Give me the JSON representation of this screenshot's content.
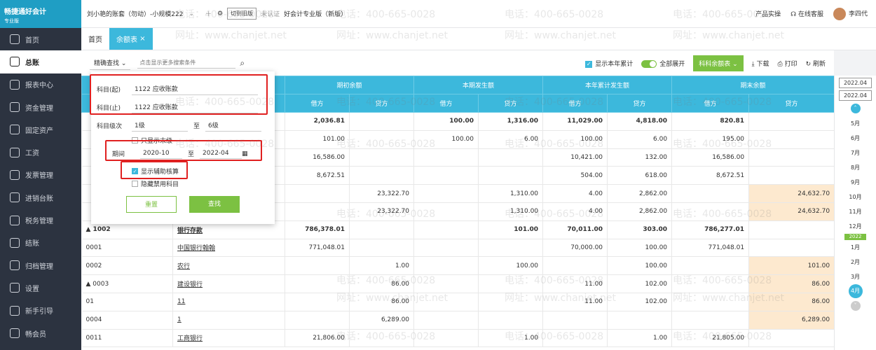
{
  "app": {
    "logo_text": "畅捷通好会计",
    "logo_sub": "专业版"
  },
  "sidebar": {
    "items": [
      {
        "label": "首页",
        "icon": "home-icon"
      },
      {
        "label": "总账",
        "icon": "ledger-icon"
      },
      {
        "label": "报表中心",
        "icon": "report-icon"
      },
      {
        "label": "资金管理",
        "icon": "fund-icon"
      },
      {
        "label": "固定资产",
        "icon": "asset-icon"
      },
      {
        "label": "工资",
        "icon": "salary-icon"
      },
      {
        "label": "发票管理",
        "icon": "invoice-icon"
      },
      {
        "label": "进销台账",
        "icon": "inventory-icon"
      },
      {
        "label": "税务管理",
        "icon": "tax-icon"
      },
      {
        "label": "结账",
        "icon": "close-icon"
      },
      {
        "label": "归档管理",
        "icon": "archive-icon"
      },
      {
        "label": "设置",
        "icon": "gear-icon"
      },
      {
        "label": "新手引导",
        "icon": "guide-icon"
      },
      {
        "label": "畅会员",
        "icon": "member-icon"
      }
    ],
    "active_index": 1
  },
  "topbar": {
    "account": "刘小艳的账套（勿动）-小规模222",
    "switch_old": "切到旧版",
    "cert": "未认证",
    "edition": "好会计专业版（新版）",
    "notice": "产品实操",
    "service": "在线客服",
    "user": "李四代"
  },
  "tabs": [
    {
      "label": "首页"
    },
    {
      "label": "余额表"
    }
  ],
  "toolbar": {
    "search_mode": "精确查找",
    "search_placeholder": "点击显示更多搜索条件",
    "show_year": "显示本年累计",
    "expand_all": "全部展开",
    "subject_balance": "科科余额表",
    "download": "下载",
    "print": "打印",
    "refresh": "刷新"
  },
  "panel": {
    "subject_from_label": "科目(起)",
    "subject_from": "1122 应收账款",
    "subject_to_label": "科目(止)",
    "subject_to": "1122 应收账款",
    "level_label": "科目级次",
    "level_from": "1级",
    "level_sep": "至",
    "level_to": "6级",
    "only_leaf": "只显示末级",
    "period_label": "期间",
    "period_from": "2020-10",
    "period_sep": "至",
    "period_to": "2022-04",
    "show_aux": "显示辅助核算",
    "hide_disabled": "隐藏禁用科目",
    "reset": "重置",
    "search": "查找"
  },
  "table": {
    "groups": [
      "期初余额",
      "本期发生额",
      "本年累计发生额",
      "期末余额"
    ],
    "sub": [
      "借方",
      "贷方"
    ],
    "rows": [
      {
        "c": [
          "",
          "",
          "2,036.81",
          "",
          "100.00",
          "1,316.00",
          "11,029.00",
          "4,818.00",
          "820.81",
          ""
        ],
        "bold": true
      },
      {
        "c": [
          "",
          "",
          "101.00",
          "",
          "100.00",
          "6.00",
          "100.00",
          "6.00",
          "195.00",
          ""
        ]
      },
      {
        "c": [
          "",
          "",
          "16,586.00",
          "",
          "",
          "",
          "10,421.00",
          "132.00",
          "16,586.00",
          ""
        ]
      },
      {
        "c": [
          "",
          "",
          "8,672.51",
          "",
          "",
          "",
          "504.00",
          "618.00",
          "8,672.51",
          ""
        ]
      },
      {
        "c": [
          "",
          "",
          "",
          "23,322.70",
          "",
          "1,310.00",
          "4.00",
          "2,862.00",
          "",
          "24,632.70"
        ]
      },
      {
        "c": [
          "",
          "",
          "",
          "23,322.70",
          "",
          "1,310.00",
          "4.00",
          "2,862.00",
          "",
          "24,632.70"
        ]
      },
      {
        "c": [
          "▲ 1002",
          "银行存款",
          "786,378.01",
          "",
          "",
          "101.00",
          "70,011.00",
          "303.00",
          "786,277.01",
          ""
        ],
        "bold": true
      },
      {
        "c": [
          "0001",
          "中国银行翰翰",
          "771,048.01",
          "",
          "",
          "",
          "70,000.00",
          "100.00",
          "771,048.01",
          ""
        ]
      },
      {
        "c": [
          "0002",
          "农行",
          "",
          "1.00",
          "",
          "100.00",
          "",
          "100.00",
          "",
          "101.00"
        ]
      },
      {
        "c": [
          "▲ 0003",
          "建设银行",
          "",
          "86.00",
          "",
          "",
          "11.00",
          "102.00",
          "",
          "86.00"
        ]
      },
      {
        "c": [
          "01",
          "11",
          "",
          "86.00",
          "",
          "",
          "11.00",
          "102.00",
          "",
          "86.00"
        ]
      },
      {
        "c": [
          "0004",
          "1",
          "",
          "6,289.00",
          "",
          "",
          "",
          "",
          "",
          "6,289.00"
        ]
      },
      {
        "c": [
          "0011",
          "工商银行",
          "21,806.00",
          "",
          "",
          "1.00",
          "",
          "1.00",
          "21,805.00",
          ""
        ]
      }
    ]
  },
  "timeline": {
    "year_from": "2022.04",
    "year_to": "2022.04",
    "months_top": [
      "5月",
      "6月",
      "7月",
      "8月",
      "9月",
      "10月",
      "11月",
      "12月"
    ],
    "year_badge": "2022",
    "months_bottom": [
      "1月",
      "2月",
      "3月"
    ],
    "active_month": "4月"
  },
  "watermark": {
    "phone": "电话：400-665-0028",
    "site": "网址：www.chanjet.net"
  }
}
